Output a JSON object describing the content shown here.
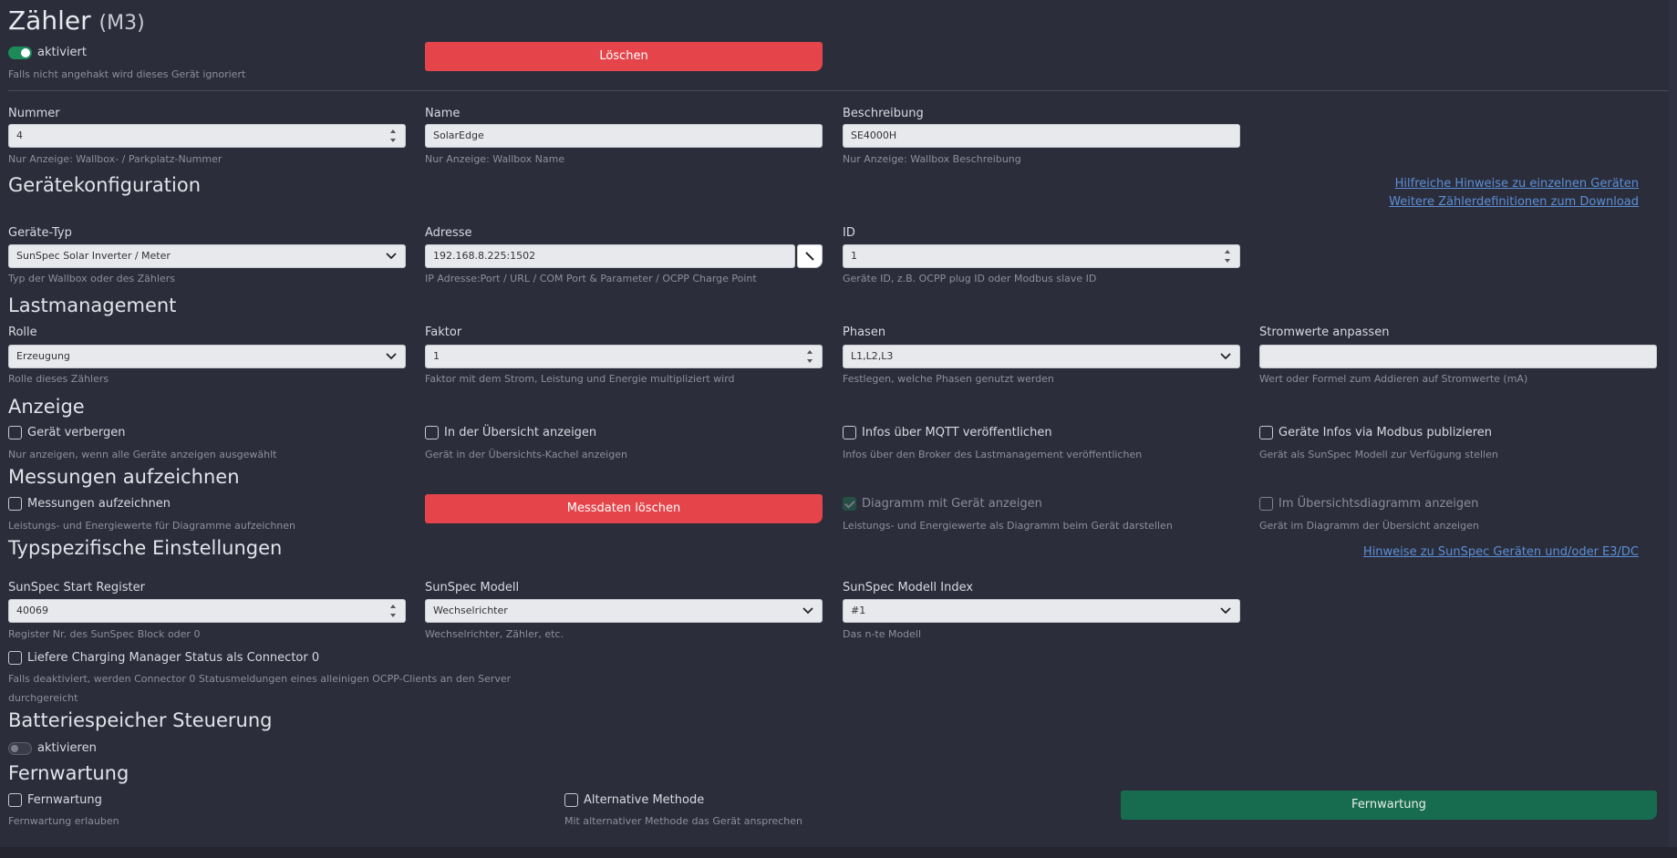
{
  "page": {
    "title": "Zähler",
    "subtitle": "(M3)"
  },
  "status": {
    "label": "aktiviert",
    "hint": "Falls nicht angehakt wird dieses Gerät ignoriert"
  },
  "delete_button": "Löschen",
  "nummer": {
    "label": "Nummer",
    "value": "4",
    "hint": "Nur Anzeige: Wallbox- / Parkplatz-Nummer"
  },
  "name": {
    "label": "Name",
    "value": "SolarEdge",
    "hint": "Nur Anzeige: Wallbox Name"
  },
  "beschreibung": {
    "label": "Beschreibung",
    "value": "SE4000H",
    "hint": "Nur Anzeige: Wallbox Beschreibung"
  },
  "geraetekonfig": {
    "title": "Gerätekonfiguration",
    "link1": "Hilfreiche Hinweise zu einzelnen Geräten",
    "link2": "Weitere Zählerdefinitionen zum Download",
    "typ": {
      "label": "Geräte-Typ",
      "value": "SunSpec Solar Inverter / Meter",
      "hint": "Typ der Wallbox oder des Zählers"
    },
    "adresse": {
      "label": "Adresse",
      "value": "192.168.8.225:1502",
      "hint": "IP Adresse:Port / URL / COM Port & Parameter / OCPP Charge Point"
    },
    "id": {
      "label": "ID",
      "value": "1",
      "hint": "Geräte ID, z.B. OCPP plug ID oder Modbus slave ID"
    }
  },
  "lastmanagement": {
    "title": "Lastmanagement",
    "rolle": {
      "label": "Rolle",
      "value": "Erzeugung",
      "hint": "Rolle dieses Zählers"
    },
    "faktor": {
      "label": "Faktor",
      "value": "1",
      "hint": "Faktor mit dem Strom, Leistung und Energie multipliziert wird"
    },
    "phasen": {
      "label": "Phasen",
      "value": "L1,L2,L3",
      "hint": "Festlegen, welche Phasen genutzt werden"
    },
    "strom": {
      "label": "Stromwerte anpassen",
      "value": "",
      "hint": "Wert oder Formel zum Addieren auf Stromwerte (mA)"
    }
  },
  "anzeige": {
    "title": "Anzeige",
    "c1": {
      "label": "Gerät verbergen",
      "hint": "Nur anzeigen, wenn alle Geräte anzeigen ausgewählt"
    },
    "c2": {
      "label": "In der Übersicht anzeigen",
      "hint": "Gerät in der Übersichts-Kachel anzeigen"
    },
    "c3": {
      "label": "Infos über MQTT veröffentlichen",
      "hint": "Infos über den Broker des Lastmanagement veröffentlichen"
    },
    "c4": {
      "label": "Geräte Infos via Modbus publizieren",
      "hint": "Gerät als SunSpec Modell zur Verfügung stellen"
    }
  },
  "messungen": {
    "title": "Messungen aufzeichnen",
    "c1": {
      "label": "Messungen aufzeichnen",
      "hint": "Leistungs- und Energiewerte für Diagramme aufzeichnen"
    },
    "button": "Messdaten löschen",
    "c3": {
      "label": "Diagramm mit Gerät anzeigen",
      "hint": "Leistungs- und Energiewerte als Diagramm beim Gerät darstellen"
    },
    "c4": {
      "label": "Im Übersichtsdiagramm anzeigen",
      "hint": "Gerät im Diagramm der Übersicht anzeigen"
    }
  },
  "typspez": {
    "title": "Typspezifische Einstellungen",
    "link": "Hinweise zu SunSpec Geräten und/oder E3/DC",
    "start": {
      "label": "SunSpec Start Register",
      "value": "40069",
      "hint": "Register Nr. des SunSpec Block oder 0"
    },
    "modell": {
      "label": "SunSpec Modell",
      "value": "Wechselrichter",
      "hint": "Wechselrichter, Zähler, etc."
    },
    "index": {
      "label": "SunSpec Modell Index",
      "value": "#1",
      "hint": "Das n-te Modell"
    },
    "connector": {
      "label": "Liefere Charging Manager Status als Connector 0",
      "hint": "Falls deaktiviert, werden Connector 0 Statusmeldungen eines alleinigen OCPP-Clients an den Server durchgereicht"
    }
  },
  "batterie": {
    "title": "Batteriespeicher Steuerung",
    "label": "aktivieren"
  },
  "fernwartung": {
    "title": "Fernwartung",
    "c1": {
      "label": "Fernwartung",
      "hint": "Fernwartung erlauben"
    },
    "c2": {
      "label": "Alternative Methode",
      "hint": "Mit alternativer Methode das Gerät ansprechen"
    },
    "button": "Fernwartung"
  }
}
